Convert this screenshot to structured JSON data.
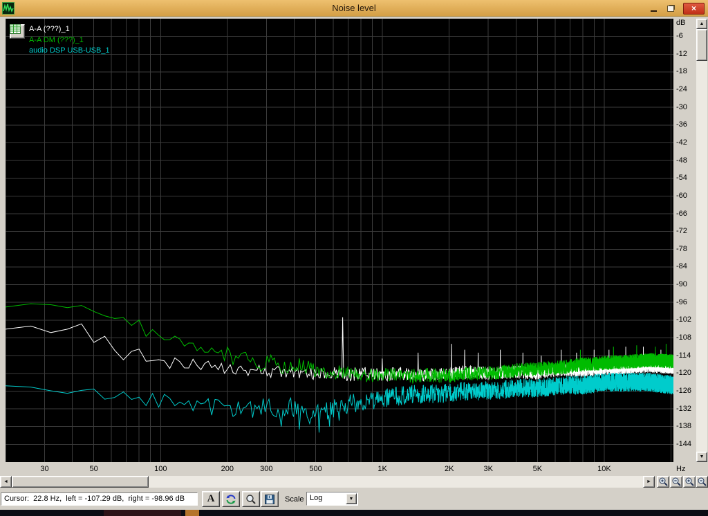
{
  "window": {
    "title": "Noise level",
    "controls": {
      "close_glyph": "×"
    }
  },
  "icons": {
    "scroll_up": "▲",
    "scroll_down": "▼",
    "scroll_left": "◄",
    "scroll_right": "►",
    "dropdown_arrow": "▼"
  },
  "axes": {
    "y_unit_label": "dB",
    "x_unit_label": "Hz"
  },
  "toolbar": {
    "status": "Cursor:  22.8 Hz,  left = -107.29 dB,  right = -98.96 dB",
    "font_button_label": "A",
    "scale_label": "Scale",
    "scale_value": "Log"
  },
  "chart_data": {
    "type": "line",
    "title": "Noise level",
    "x_scale": "log",
    "x_unit": "Hz",
    "y_unit": "dB",
    "x_range": [
      20,
      20500
    ],
    "y_range": [
      -150,
      0
    ],
    "grid_on": true,
    "grid_color": "#3c3c3c",
    "background": "#000000",
    "legend_position": "top-left",
    "y_ticks": [
      -6,
      -12,
      -18,
      -24,
      -30,
      -36,
      -42,
      -48,
      -54,
      -60,
      -66,
      -72,
      -78,
      -84,
      -90,
      -96,
      -102,
      -108,
      -114,
      -120,
      -126,
      -132,
      -138,
      -144
    ],
    "x_tick_labels": [
      {
        "f": 30,
        "label": "30"
      },
      {
        "f": 50,
        "label": "50"
      },
      {
        "f": 100,
        "label": "100"
      },
      {
        "f": 200,
        "label": "200"
      },
      {
        "f": 300,
        "label": "300"
      },
      {
        "f": 500,
        "label": "500"
      },
      {
        "f": 1000,
        "label": "1K"
      },
      {
        "f": 2000,
        "label": "2K"
      },
      {
        "f": 3000,
        "label": "3K"
      },
      {
        "f": 5000,
        "label": "5K"
      },
      {
        "f": 10000,
        "label": "10K"
      }
    ],
    "grid_frequencies": [
      20,
      30,
      40,
      50,
      60,
      70,
      80,
      90,
      100,
      200,
      300,
      400,
      500,
      600,
      700,
      800,
      900,
      1000,
      2000,
      3000,
      4000,
      5000,
      6000,
      7000,
      8000,
      9000,
      10000,
      20000
    ],
    "series": [
      {
        "name": "A-A (???)_1",
        "color": "#ffffff",
        "noise_db": 2.2,
        "envelope_points": [
          [
            20,
            -104.5
          ],
          [
            24,
            -105.5
          ],
          [
            28,
            -104
          ],
          [
            32,
            -106.5
          ],
          [
            36,
            -104.5
          ],
          [
            40,
            -106
          ],
          [
            44,
            -104
          ],
          [
            48,
            -108
          ],
          [
            52,
            -111.5
          ],
          [
            56,
            -108
          ],
          [
            60,
            -113
          ],
          [
            64,
            -109.5
          ],
          [
            68,
            -115
          ],
          [
            72,
            -111
          ],
          [
            76,
            -116
          ],
          [
            80,
            -112
          ],
          [
            85,
            -117
          ],
          [
            90,
            -113.5
          ],
          [
            95,
            -117
          ],
          [
            100,
            -115
          ],
          [
            110,
            -117.5
          ],
          [
            120,
            -115
          ],
          [
            130,
            -118
          ],
          [
            140,
            -116.5
          ],
          [
            155,
            -118
          ],
          [
            170,
            -117
          ],
          [
            190,
            -118.5
          ],
          [
            210,
            -118
          ],
          [
            240,
            -119
          ],
          [
            270,
            -119.5
          ],
          [
            300,
            -119
          ],
          [
            350,
            -120
          ],
          [
            400,
            -119.5
          ],
          [
            500,
            -120.5
          ],
          [
            600,
            -120
          ],
          [
            700,
            -120.5
          ],
          [
            850,
            -120
          ],
          [
            1000,
            -120.5
          ],
          [
            1200,
            -120
          ],
          [
            1500,
            -120.5
          ],
          [
            2000,
            -120
          ],
          [
            2500,
            -119.5
          ],
          [
            3000,
            -120
          ],
          [
            4000,
            -119.5
          ],
          [
            5000,
            -120
          ],
          [
            6000,
            -119
          ],
          [
            8000,
            -119
          ],
          [
            10000,
            -118.5
          ],
          [
            13000,
            -118
          ],
          [
            16000,
            -117.5
          ],
          [
            20500,
            -118
          ]
        ],
        "peaks": [
          [
            660,
            -101
          ],
          [
            1000,
            -115
          ],
          [
            1450,
            -113
          ],
          [
            2050,
            -110
          ],
          [
            2350,
            -112
          ],
          [
            2700,
            -113
          ],
          [
            3400,
            -112
          ],
          [
            4300,
            -113
          ],
          [
            5200,
            -114
          ],
          [
            6400,
            -112
          ],
          [
            7500,
            -113
          ],
          [
            9000,
            -112
          ],
          [
            10500,
            -112
          ],
          [
            12500,
            -111
          ],
          [
            15000,
            -111
          ],
          [
            18000,
            -112
          ]
        ]
      },
      {
        "name": "A-A DM (???)_1",
        "color": "#00bb00",
        "noise_db": 2.4,
        "envelope_points": [
          [
            20,
            -98
          ],
          [
            25,
            -97
          ],
          [
            30,
            -98.5
          ],
          [
            35,
            -96.5
          ],
          [
            40,
            -98
          ],
          [
            45,
            -97
          ],
          [
            50,
            -99
          ],
          [
            55,
            -101
          ],
          [
            60,
            -98.5
          ],
          [
            65,
            -103
          ],
          [
            70,
            -100
          ],
          [
            75,
            -105
          ],
          [
            80,
            -102
          ],
          [
            85,
            -107
          ],
          [
            90,
            -104
          ],
          [
            95,
            -108
          ],
          [
            100,
            -105.5
          ],
          [
            110,
            -110
          ],
          [
            120,
            -107
          ],
          [
            130,
            -112
          ],
          [
            140,
            -109
          ],
          [
            150,
            -113
          ],
          [
            165,
            -111
          ],
          [
            180,
            -115
          ],
          [
            200,
            -113
          ],
          [
            220,
            -116
          ],
          [
            250,
            -114.5
          ],
          [
            280,
            -117
          ],
          [
            320,
            -116
          ],
          [
            360,
            -118
          ],
          [
            420,
            -117
          ],
          [
            500,
            -119
          ],
          [
            600,
            -120
          ],
          [
            700,
            -119
          ],
          [
            850,
            -121
          ],
          [
            1000,
            -120
          ],
          [
            1300,
            -121
          ],
          [
            1600,
            -120.5
          ],
          [
            2000,
            -121
          ],
          [
            2500,
            -120
          ],
          [
            3000,
            -120
          ],
          [
            4000,
            -119
          ],
          [
            5000,
            -118.5
          ],
          [
            6500,
            -118
          ],
          [
            8000,
            -117
          ],
          [
            10000,
            -116.5
          ],
          [
            13000,
            -116
          ],
          [
            16000,
            -115.5
          ],
          [
            20500,
            -116
          ]
        ],
        "peaks": [
          [
            7800,
            -112
          ],
          [
            11000,
            -111
          ],
          [
            14000,
            -110.5
          ],
          [
            17000,
            -111
          ],
          [
            19000,
            -110
          ]
        ]
      },
      {
        "name": "audio DSP USB-USB_1",
        "color": "#00cccc",
        "noise_db": 3.2,
        "envelope_points": [
          [
            20,
            -125
          ],
          [
            25,
            -126
          ],
          [
            30,
            -124.5
          ],
          [
            35,
            -126.5
          ],
          [
            40,
            -125
          ],
          [
            45,
            -127
          ],
          [
            50,
            -125
          ],
          [
            55,
            -128
          ],
          [
            60,
            -125.5
          ],
          [
            65,
            -129
          ],
          [
            70,
            -126
          ],
          [
            75,
            -130
          ],
          [
            80,
            -127
          ],
          [
            85,
            -131
          ],
          [
            90,
            -128
          ],
          [
            100,
            -130
          ],
          [
            110,
            -127.5
          ],
          [
            120,
            -131
          ],
          [
            130,
            -128
          ],
          [
            140,
            -132
          ],
          [
            155,
            -129
          ],
          [
            170,
            -132
          ],
          [
            190,
            -130
          ],
          [
            210,
            -133
          ],
          [
            240,
            -130
          ],
          [
            270,
            -133
          ],
          [
            300,
            -131
          ],
          [
            340,
            -134
          ],
          [
            380,
            -131
          ],
          [
            430,
            -134
          ],
          [
            480,
            -132
          ],
          [
            550,
            -133
          ],
          [
            650,
            -131
          ],
          [
            750,
            -130
          ],
          [
            900,
            -129
          ],
          [
            1100,
            -128
          ],
          [
            1400,
            -127
          ],
          [
            1800,
            -127
          ],
          [
            2300,
            -126
          ],
          [
            3000,
            -126
          ],
          [
            4000,
            -125
          ],
          [
            5000,
            -125
          ],
          [
            6500,
            -124
          ],
          [
            8000,
            -124
          ],
          [
            10000,
            -123
          ],
          [
            13000,
            -123
          ],
          [
            16000,
            -123
          ],
          [
            20500,
            -124
          ]
        ],
        "peaks": [
          [
            350,
            -138
          ],
          [
            420,
            -139
          ],
          [
            470,
            -137
          ],
          [
            520,
            -140
          ],
          [
            580,
            -138
          ],
          [
            640,
            -136
          ]
        ]
      }
    ]
  }
}
